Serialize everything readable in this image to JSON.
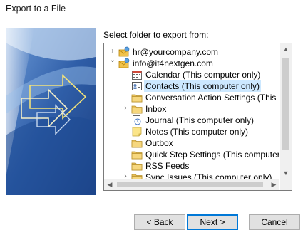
{
  "window": {
    "title": "Export to a File"
  },
  "dialog": {
    "prompt": "Select folder to export from:"
  },
  "tree": {
    "items": [
      {
        "label": "hr@yourcompany.com",
        "icon": "mailbox-icon",
        "arrow": ">",
        "selected": false
      },
      {
        "label": "info@it4nextgen.com",
        "icon": "mailbox-icon",
        "arrow": "v",
        "selected": false
      },
      {
        "label": "Calendar (This computer only)",
        "icon": "calendar-icon",
        "arrow": "",
        "selected": false
      },
      {
        "label": "Contacts (This computer only)",
        "icon": "contacts-icon",
        "arrow": "",
        "selected": true
      },
      {
        "label": "Conversation Action Settings (This c",
        "icon": "folder-icon",
        "arrow": "",
        "selected": false
      },
      {
        "label": "Inbox",
        "icon": "folder-icon",
        "arrow": ">",
        "selected": false
      },
      {
        "label": "Journal (This computer only)",
        "icon": "journal-icon",
        "arrow": "",
        "selected": false
      },
      {
        "label": "Notes (This computer only)",
        "icon": "notes-icon",
        "arrow": "",
        "selected": false
      },
      {
        "label": "Outbox",
        "icon": "folder-icon",
        "arrow": "",
        "selected": false
      },
      {
        "label": "Quick Step Settings (This computer c",
        "icon": "folder-icon",
        "arrow": "",
        "selected": false
      },
      {
        "label": "RSS Feeds",
        "icon": "folder-icon",
        "arrow": "",
        "selected": false
      },
      {
        "label": "Sync Issues (This computer only)",
        "icon": "folder-icon",
        "arrow": ">",
        "selected": false
      }
    ]
  },
  "buttons": {
    "back": "< Back",
    "next": "Next >",
    "cancel": "Cancel"
  }
}
